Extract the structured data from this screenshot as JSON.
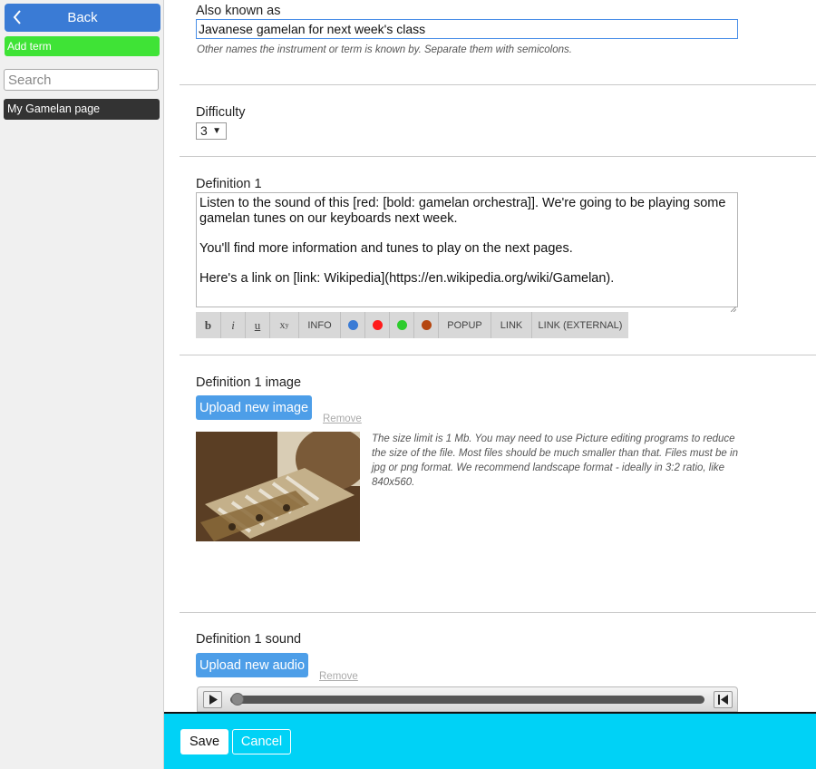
{
  "sidebar": {
    "back_label": "Back",
    "add_term_label": "Add term",
    "search_placeholder": "Search",
    "page_link_label": "My Gamelan page"
  },
  "also_known_as": {
    "label": "Also known as",
    "value": "Javanese gamelan for next week's class",
    "hint": "Other names the instrument or term is known by. Separate them with semicolons."
  },
  "difficulty": {
    "label": "Difficulty",
    "selected": "3"
  },
  "definition": {
    "label": "Definition 1",
    "text": "Listen to the sound of this [red: [bold: gamelan orchestra]]. We're going to be playing some gamelan tunes on our keyboards next week.\n\nYou'll find more information and tunes to play on the next pages.\n\nHere's a link on [link: Wikipedia](https://en.wikipedia.org/wiki/Gamelan).",
    "toolbar": {
      "bold": "b",
      "italic": "i",
      "underline": "u",
      "superscript": "x",
      "superscript_y": "y",
      "info": "INFO",
      "popup": "POPUP",
      "link": "LINK",
      "link_external": "LINK (EXTERNAL)",
      "colors": [
        "#3a7bd5",
        "#ff1a1a",
        "#2ecc2e",
        "#b5460f"
      ]
    }
  },
  "image_section": {
    "label": "Definition 1 image",
    "upload_label": "Upload new image",
    "remove_label": "Remove",
    "hint": "The size limit is 1 Mb. You may need to use Picture editing programs to reduce the size of the file. Most files should be much smaller than that. Files must be in jpg or png format. We recommend landscape format - ideally in 3:2 ratio, like 840x560."
  },
  "sound_section": {
    "label": "Definition 1 sound",
    "upload_label": "Upload new audio",
    "remove_label": "Remove"
  },
  "footer": {
    "save_label": "Save",
    "cancel_label": "Cancel"
  },
  "colors": {
    "back": "#3a7bd5",
    "add_term": "#3fe336",
    "footer": "#00d2f6",
    "upload": "#4d9ee8"
  }
}
